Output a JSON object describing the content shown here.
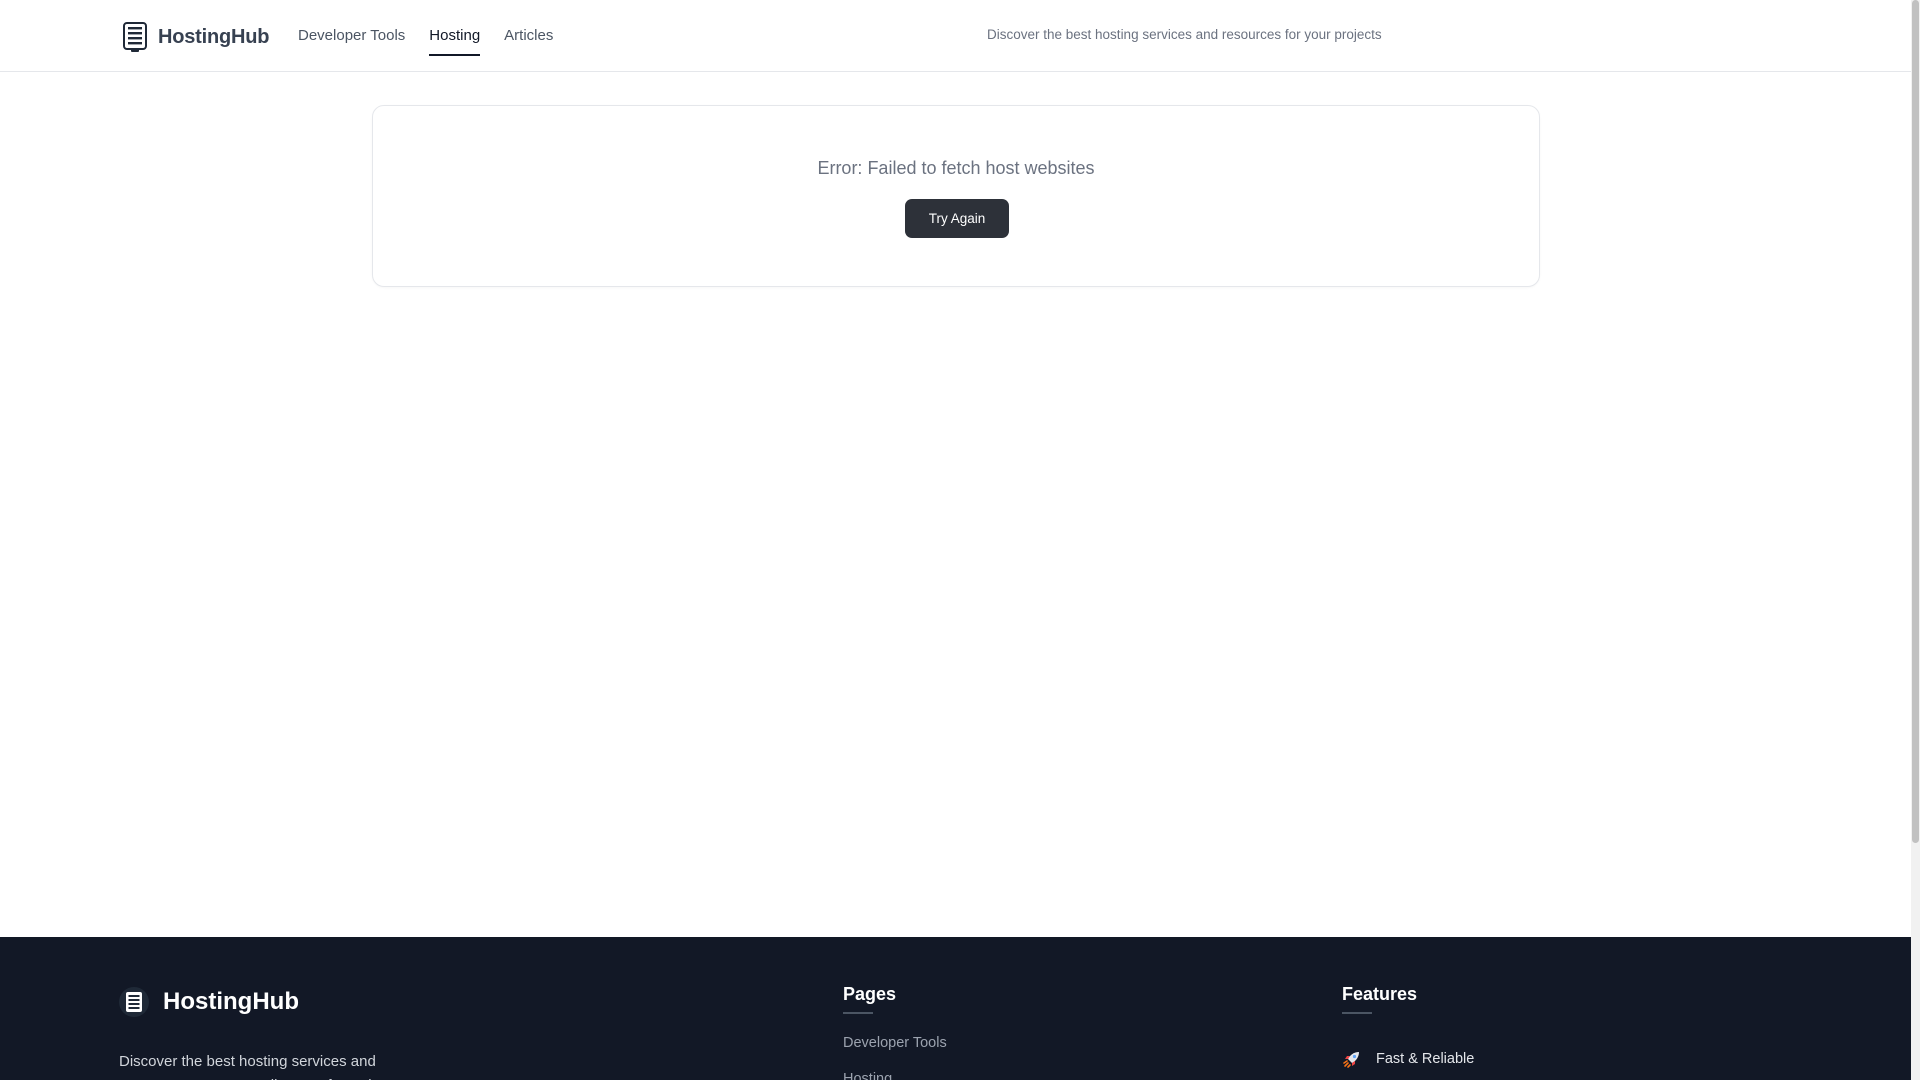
{
  "header": {
    "brand": "HostingHub",
    "nav": [
      {
        "label": "Developer Tools",
        "active": false
      },
      {
        "label": "Hosting",
        "active": true
      },
      {
        "label": "Articles",
        "active": false
      }
    ],
    "tagline": "Discover the best hosting services and resources for your projects"
  },
  "error": {
    "message": "Error: Failed to fetch host websites",
    "retry_label": "Try Again"
  },
  "footer": {
    "brand": "HostingHub",
    "description": "Discover the best hosting services and resources. Your go-to directory for web",
    "pages_title": "Pages",
    "pages": [
      "Developer Tools",
      "Hosting"
    ],
    "features_title": "Features",
    "features": [
      {
        "label": "Fast & Reliable",
        "icon": "rocket-icon"
      }
    ]
  },
  "colors": {
    "footer_bg": "#121826",
    "button_bg": "#2d3139",
    "active_underline": "#111827"
  }
}
